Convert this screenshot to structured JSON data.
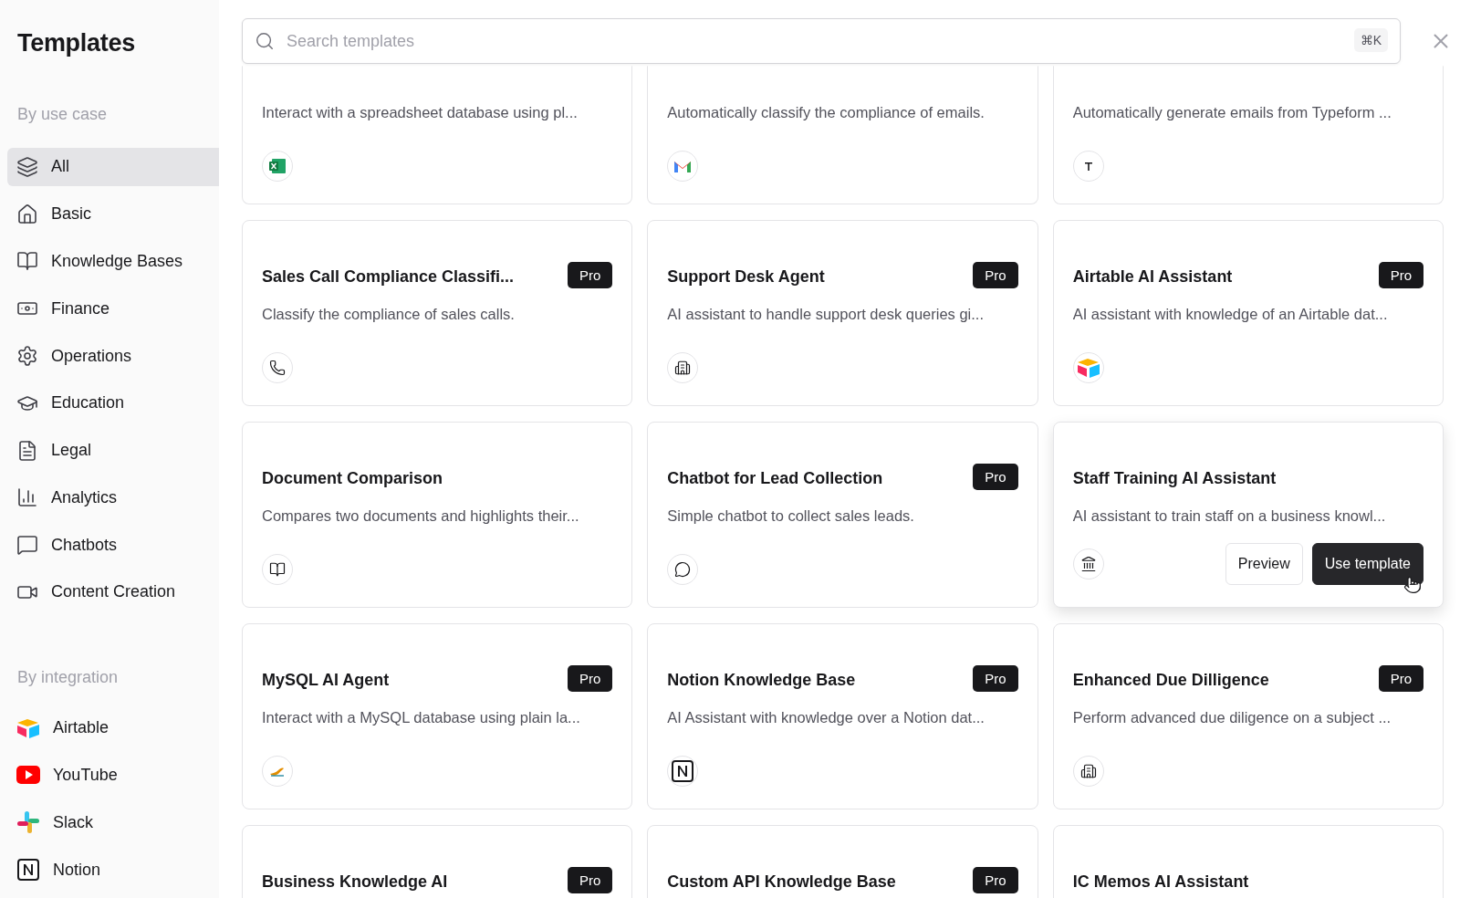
{
  "sidebar": {
    "title": "Templates",
    "sections": [
      {
        "heading": "By use case",
        "items": [
          {
            "label": "All",
            "selected": true
          },
          {
            "label": "Basic",
            "selected": false
          },
          {
            "label": "Knowledge Bases",
            "selected": false
          },
          {
            "label": "Finance",
            "selected": false
          },
          {
            "label": "Operations",
            "selected": false
          },
          {
            "label": "Education",
            "selected": false
          },
          {
            "label": "Legal",
            "selected": false
          },
          {
            "label": "Analytics",
            "selected": false
          },
          {
            "label": "Chatbots",
            "selected": false
          },
          {
            "label": "Content Creation",
            "selected": false
          }
        ]
      },
      {
        "heading": "By integration",
        "items": [
          {
            "label": "Airtable",
            "selected": false
          },
          {
            "label": "YouTube",
            "selected": false
          },
          {
            "label": "Slack",
            "selected": false
          },
          {
            "label": "Notion",
            "selected": false
          }
        ]
      }
    ]
  },
  "search": {
    "placeholder": "Search templates",
    "shortcut": "⌘K"
  },
  "cards": [
    {
      "description": "Interact with a spreadsheet database using pl...",
      "hovered": false
    },
    {
      "description": "Automatically classify the compliance of emails.",
      "hovered": false
    },
    {
      "description": "Automatically generate emails from Typeform ...",
      "hovered": false
    },
    {
      "title": "Sales Call Compliance Classifi...",
      "badge": "Pro",
      "description": "Classify the compliance of sales calls.",
      "hovered": false
    },
    {
      "title": "Support Desk Agent",
      "badge": "Pro",
      "description": "AI assistant to handle support desk queries gi...",
      "hovered": false
    },
    {
      "title": "Airtable AI Assistant",
      "badge": "Pro",
      "description": "AI assistant with knowledge of an Airtable dat...",
      "hovered": false
    },
    {
      "title": "Document Comparison",
      "description": "Compares two documents and highlights their...",
      "hovered": false
    },
    {
      "title": "Chatbot for Lead Collection",
      "badge": "Pro",
      "description": "Simple chatbot to collect sales leads.",
      "hovered": false
    },
    {
      "title": "Staff Training AI Assistant",
      "description": "AI assistant to train staff on a business knowl...",
      "hovered": true,
      "actions": [
        "Preview",
        "Use template"
      ]
    },
    {
      "title": "MySQL AI Agent",
      "badge": "Pro",
      "description": "Interact with a MySQL database using plain la...",
      "hovered": false
    },
    {
      "title": "Notion Knowledge Base",
      "badge": "Pro",
      "description": "AI Assistant with knowledge over a Notion dat...",
      "hovered": false
    },
    {
      "title": "Enhanced Due Dilligence",
      "badge": "Pro",
      "description": "Perform advanced due diligence on a subject ...",
      "hovered": false
    },
    {
      "title": "Business Knowledge AI",
      "badge": "Pro",
      "hovered": false
    },
    {
      "title": "Custom API Knowledge Base",
      "badge": "Pro",
      "hovered": false
    },
    {
      "title": "IC Memos AI Assistant",
      "hovered": false
    }
  ]
}
